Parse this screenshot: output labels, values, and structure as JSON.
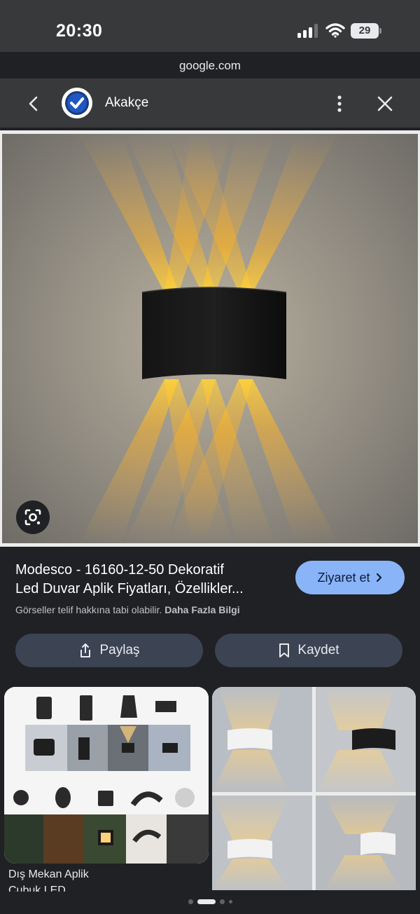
{
  "status_bar": {
    "time": "20:30",
    "battery": "29",
    "icons": [
      "cellular-signal-icon",
      "wifi-icon",
      "battery-icon"
    ]
  },
  "browser": {
    "domain": "google.com"
  },
  "header": {
    "site_name": "Akakçe",
    "icons": [
      "back-icon",
      "site-logo-icon",
      "more-vert-icon",
      "close-icon"
    ]
  },
  "result": {
    "title_line1": "Modesco - 16160-12-50 Dekoratif",
    "title_line2": "Led Duvar Aplik Fiyatları, Özellikler...",
    "visit_label": "Ziyaret et",
    "copyright_text": "Görseller telif hakkına tabi olabilir.",
    "copyright_link": "Daha Fazla Bilgi",
    "share_label": "Paylaş",
    "save_label": "Kaydet"
  },
  "related": {
    "caption_line1": "Dış Mekan Aplik",
    "caption_line2": "Çubuk LED"
  },
  "pager": {
    "count": 4,
    "active_index": 1
  },
  "colors": {
    "background": "#202124",
    "bar": "#38393b",
    "accent": "#8ab4f8",
    "button": "#3c4353",
    "glow": "#ffb21e"
  }
}
